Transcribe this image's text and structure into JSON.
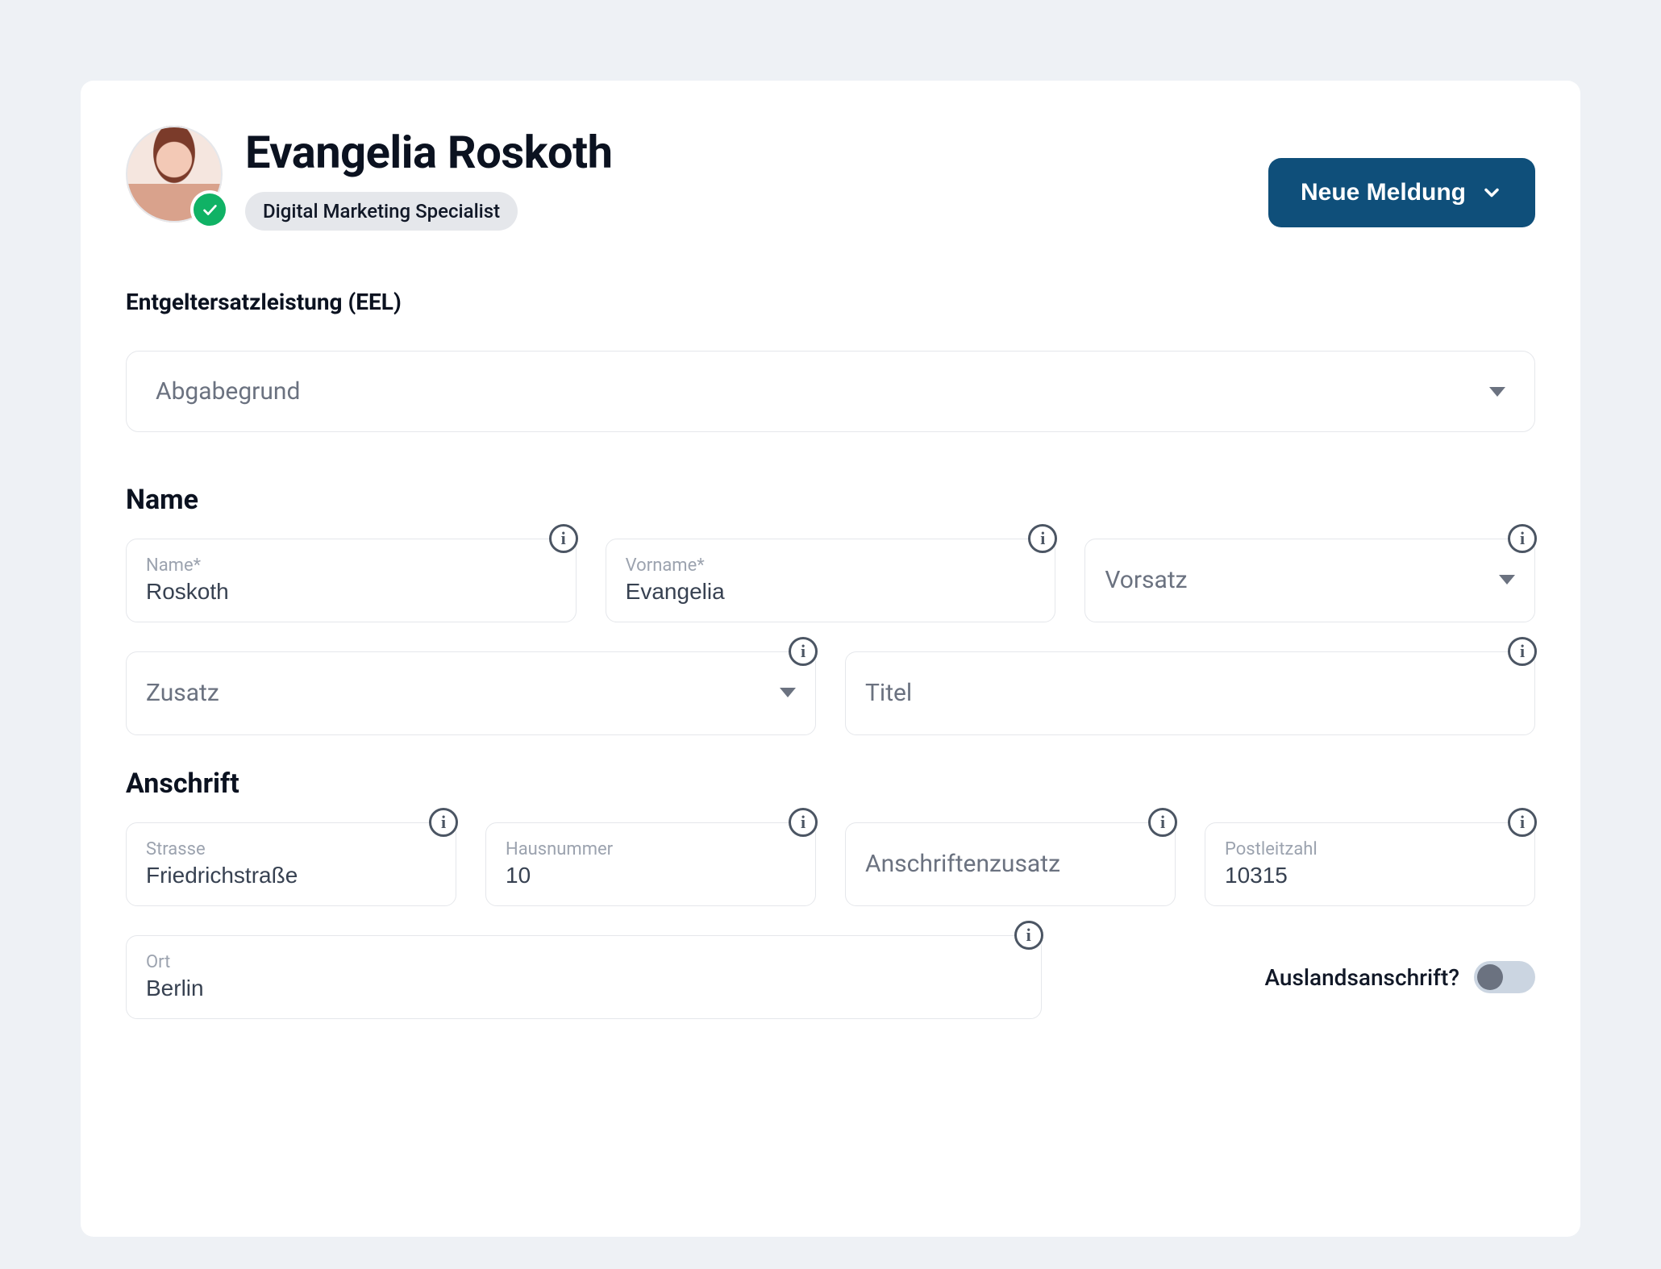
{
  "header": {
    "name": "Evangelia Roskoth",
    "role": "Digital Marketing Specialist",
    "primary_button": "Neue Meldung"
  },
  "section_title": "Entgeltersatzleistung (EEL)",
  "abgabegrund": {
    "placeholder": "Abgabegrund"
  },
  "name_section": {
    "heading": "Name",
    "name": {
      "label": "Name*",
      "value": "Roskoth"
    },
    "vorname": {
      "label": "Vorname*",
      "value": "Evangelia"
    },
    "vorsatz": {
      "placeholder": "Vorsatz"
    },
    "zusatz": {
      "placeholder": "Zusatz"
    },
    "titel": {
      "placeholder": "Titel"
    }
  },
  "anschrift_section": {
    "heading": "Anschrift",
    "strasse": {
      "label": "Strasse",
      "value": "Friedrichstraße"
    },
    "hausnummer": {
      "label": "Hausnummer",
      "value": "10"
    },
    "anschriftenzusatz": {
      "placeholder": "Anschriftenzusatz"
    },
    "plz": {
      "label": "Postleitzahl",
      "value": "10315"
    },
    "ort": {
      "label": "Ort",
      "value": "Berlin"
    },
    "ausland_label": "Auslandsanschrift?",
    "ausland_on": false
  }
}
